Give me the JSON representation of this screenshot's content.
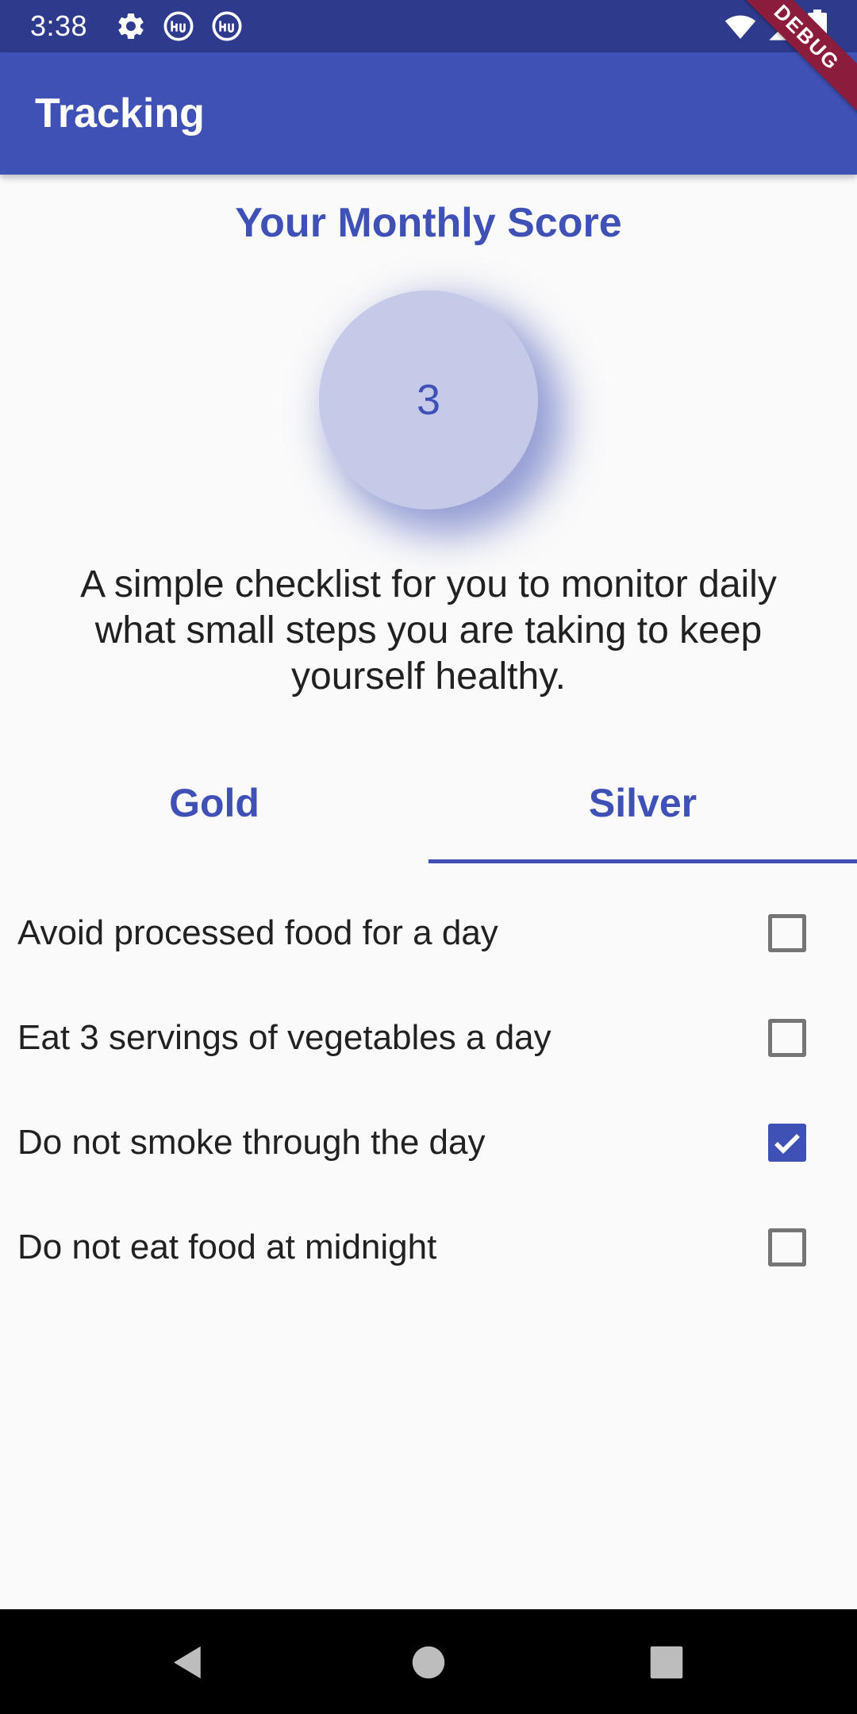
{
  "status_bar": {
    "time": "3:38",
    "icons": [
      "gear-icon",
      "hub-icon",
      "hub-icon",
      "wifi-icon",
      "signal-icon",
      "battery-icon"
    ]
  },
  "app_bar": {
    "title": "Tracking",
    "color": "#3f51b5"
  },
  "debug_banner": "DEBUG",
  "score": {
    "title": "Your Monthly Score",
    "value": "3"
  },
  "description": "A simple checklist for you to monitor daily what small steps you are taking to keep yourself healthy.",
  "tabs": [
    {
      "label": "Gold",
      "selected": false
    },
    {
      "label": "Silver",
      "selected": true
    }
  ],
  "checklist": [
    {
      "label": "Avoid processed food for a day",
      "checked": false
    },
    {
      "label": "Eat 3 servings of vegetables a day",
      "checked": false
    },
    {
      "label": "Do not smoke through the day",
      "checked": true
    },
    {
      "label": "Do not eat food at midnight",
      "checked": false
    }
  ],
  "nav_bar": {
    "buttons": [
      "back-icon",
      "home-icon",
      "recents-icon"
    ]
  },
  "colors": {
    "primary": "#3f51b5",
    "primary_dark": "#2e3b8d",
    "score_circle": "#c5cae9",
    "debug_ribbon": "#8b1c3c"
  }
}
